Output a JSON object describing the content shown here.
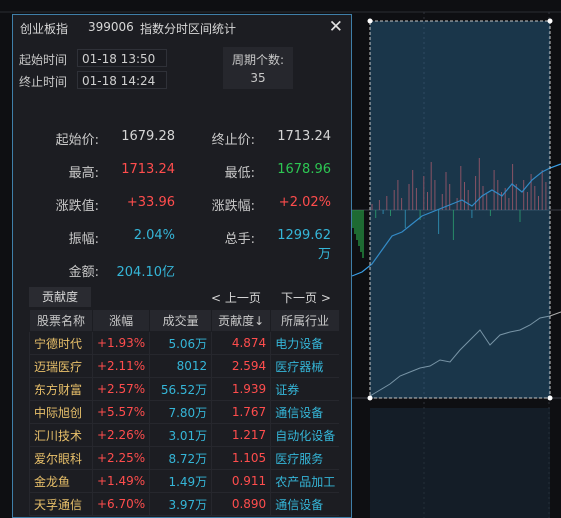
{
  "header": {
    "index_name": "创业板指",
    "index_code": "399006",
    "title": "指数分时区间统计",
    "close_glyph": "✕"
  },
  "time": {
    "start_label": "起始时间",
    "start_value": "01-18 13:50",
    "end_label": "终止时间",
    "end_value": "01-18 14:24"
  },
  "period": {
    "label": "周期个数:",
    "value": "35"
  },
  "stats": {
    "open_label": "起始价:",
    "open_value": "1679.28",
    "close_label": "终止价:",
    "close_value": "1713.24",
    "high_label": "最高:",
    "high_value": "1713.24",
    "low_label": "最低:",
    "low_value": "1678.96",
    "chg_label": "涨跌值:",
    "chg_value": "+33.96",
    "chgpct_label": "涨跌幅:",
    "chgpct_value": "+2.02%",
    "amp_label": "振幅:",
    "amp_value": "2.04%",
    "vol_label": "总手:",
    "vol_value": "1299.62万",
    "amt_label": "金额:",
    "amt_value": "204.10亿"
  },
  "tabs": {
    "contribution": "贡献度",
    "prev_page": "< 上一页",
    "next_page": "下一页 >"
  },
  "table": {
    "headers": [
      "股票名称",
      "涨幅",
      "成交量",
      "贡献度↓",
      "所属行业"
    ],
    "rows": [
      [
        "宁德时代",
        "+1.93%",
        "5.06万",
        "4.874",
        "电力设备"
      ],
      [
        "迈瑞医疗",
        "+2.11%",
        "8012",
        "2.594",
        "医疗器械"
      ],
      [
        "东方财富",
        "+2.57%",
        "56.52万",
        "1.939",
        "证券"
      ],
      [
        "中际旭创",
        "+5.57%",
        "7.80万",
        "1.767",
        "通信设备"
      ],
      [
        "汇川技术",
        "+2.26%",
        "3.01万",
        "1.217",
        "自动化设备"
      ],
      [
        "爱尔眼科",
        "+2.25%",
        "8.72万",
        "1.105",
        "医疗服务"
      ],
      [
        "金龙鱼",
        "+1.49%",
        "1.49万",
        "0.911",
        "农产品加工"
      ],
      [
        "天孚通信",
        "+6.70%",
        "3.97万",
        "0.890",
        "通信设备"
      ]
    ]
  },
  "colors": {
    "up": "#ff4d4d",
    "down": "#2dc653",
    "accent": "#35b6d8",
    "stock_name": "#e8c06a",
    "panel_border": "#3f7fa8"
  }
}
